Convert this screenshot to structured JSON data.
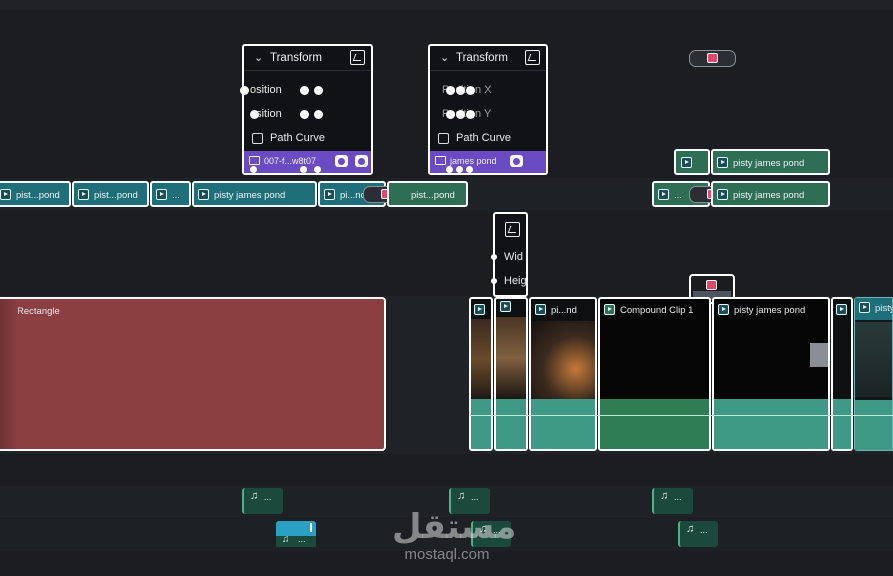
{
  "popups": {
    "left": {
      "title": "Transform",
      "rows": [
        "osition",
        "osition"
      ],
      "checkbox_label": "Path Curve",
      "clip_label": "007-f...w8t07"
    },
    "middle": {
      "title": "Transform",
      "rows": [
        "Position X",
        "Position Y"
      ],
      "checkbox_label": "Path Curve",
      "clip_label": "james pond"
    },
    "narrow": {
      "rows": [
        "Wid",
        "Heig"
      ]
    }
  },
  "track_v3": {
    "clips": [
      "pisty james pond"
    ]
  },
  "track_v2": {
    "clips": [
      "pist...pond",
      "pist...pond",
      "...",
      "pisty james pond",
      "pi...nd",
      "pist...pond",
      "...",
      "pisty james pond"
    ]
  },
  "track_v1": {
    "rectangle_label": "Rectangle",
    "clips": [
      "pi...nd",
      "Compound Clip 1",
      "pisty james pond",
      "pisty"
    ]
  },
  "audio_tracks": {
    "labels": [
      "...",
      "...",
      "...",
      "...",
      "...",
      "..."
    ]
  },
  "watermark": {
    "arabic": "مستقل",
    "latin": "mostaql.com"
  },
  "colors": {
    "background": "#1b1d21",
    "video_clip": "#1f6f7a",
    "green_clip": "#2d6e55",
    "rectangle": "#8c3f40",
    "purple_bar": "#6a4bc4",
    "selection": "#ffffff"
  }
}
